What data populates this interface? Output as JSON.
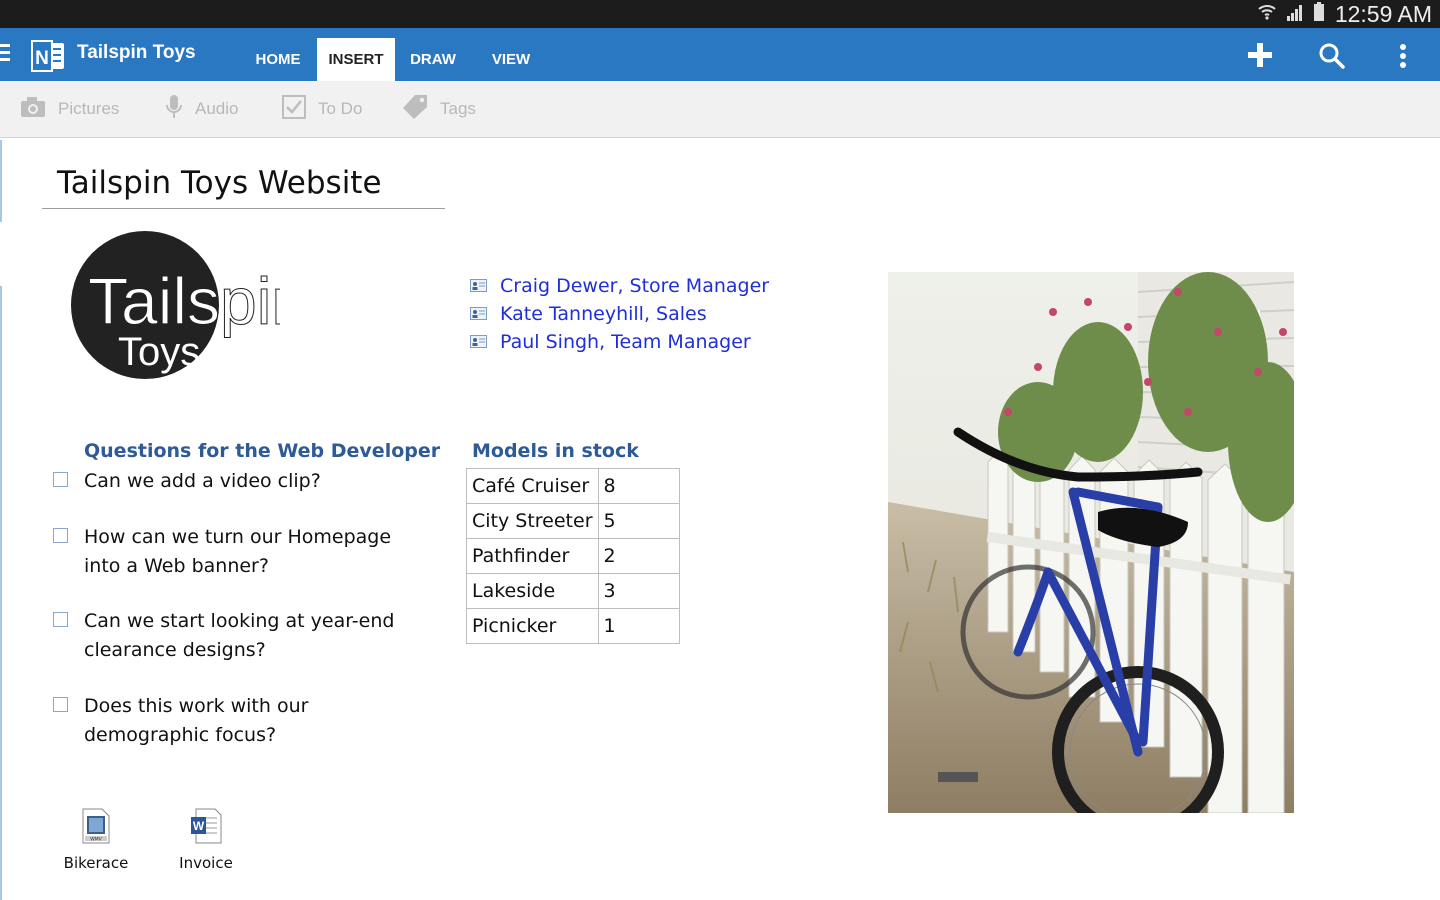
{
  "status_bar": {
    "time": "12:59 AM",
    "icons": [
      "wifi-icon",
      "signal-icon",
      "battery-icon"
    ]
  },
  "app_bar": {
    "title": "Tailspin Toys",
    "tabs": [
      {
        "label": "HOME",
        "active": false
      },
      {
        "label": "INSERT",
        "active": true
      },
      {
        "label": "DRAW",
        "active": false
      },
      {
        "label": "VIEW",
        "active": false
      }
    ],
    "actions": [
      "plus-icon",
      "search-icon",
      "more-vertical-icon"
    ]
  },
  "ribbon": {
    "buttons": [
      {
        "label": "Pictures",
        "icon": "camera-icon"
      },
      {
        "label": "Audio",
        "icon": "microphone-icon"
      },
      {
        "label": "To Do",
        "icon": "checkbox-icon"
      },
      {
        "label": "Tags",
        "icon": "tag-icon"
      }
    ]
  },
  "page": {
    "title": "Tailspin Toys Website",
    "logo": {
      "line1": "Tailspin",
      "line2": "Toys"
    },
    "contacts": [
      "Craig Dewer, Store Manager",
      "Kate Tanneyhill, Sales",
      "Paul Singh, Team Manager"
    ],
    "questions": {
      "heading": "Questions for the Web Developer",
      "items": [
        "Can we add a video clip?",
        "How can we turn our Homepage into a Web banner?",
        "Can we start looking at year-end clearance designs?",
        "Does this work with our demographic focus?"
      ]
    },
    "stock": {
      "heading": "Models in stock",
      "rows": [
        [
          "Café Cruiser",
          "8"
        ],
        [
          "City Streeter",
          "5"
        ],
        [
          "Pathfinder",
          "2"
        ],
        [
          "Lakeside",
          "3"
        ],
        [
          "Picnicker",
          "1"
        ]
      ]
    },
    "attachments": [
      {
        "label": "Bikerace",
        "icon": "wmv-file-icon"
      },
      {
        "label": "Invoice",
        "icon": "word-doc-icon"
      }
    ]
  },
  "colors": {
    "app_bar": "#2b78c2",
    "heading": "#2e5a96",
    "link": "#1f2fd8"
  }
}
